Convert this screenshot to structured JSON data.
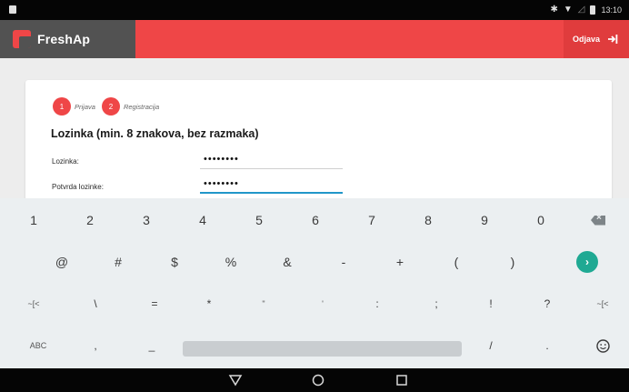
{
  "status_bar": {
    "time": "13:10",
    "icons": [
      "notification-icon",
      "bluetooth-icon",
      "wifi-icon",
      "signal-icon",
      "battery-icon"
    ]
  },
  "header": {
    "app_name": "FreshAp",
    "logout_label": "Odjava",
    "logout_icon": "logout-icon",
    "accent_color": "#ef4647",
    "brand_bg": "#525252"
  },
  "steps": [
    {
      "number": "1",
      "label": "Prijava"
    },
    {
      "number": "2",
      "label": "Registracija"
    }
  ],
  "form": {
    "title": "Lozinka (min. 8 znakova, bez razmaka)",
    "password_label": "Lozinka:",
    "password_value": "••••••••",
    "confirm_label": "Potvrda lozinke:",
    "confirm_value": "••••••••",
    "active_underline": "#2196c9"
  },
  "keyboard": {
    "row1": [
      "1",
      "2",
      "3",
      "4",
      "5",
      "6",
      "7",
      "8",
      "9",
      "0"
    ],
    "row2": [
      "@",
      "#",
      "$",
      "%",
      "&",
      "-",
      "+",
      "(",
      ")"
    ],
    "row3": [
      "~[<",
      "\\",
      "=",
      "*",
      "\"",
      "'",
      ":",
      ";",
      "!",
      "?",
      "~[<"
    ],
    "row4_left": [
      "ABC",
      ",",
      "_"
    ],
    "row4_right": [
      "/",
      "."
    ],
    "go_color": "#1fa993"
  },
  "nav": [
    "back-icon",
    "home-icon",
    "recents-icon"
  ]
}
